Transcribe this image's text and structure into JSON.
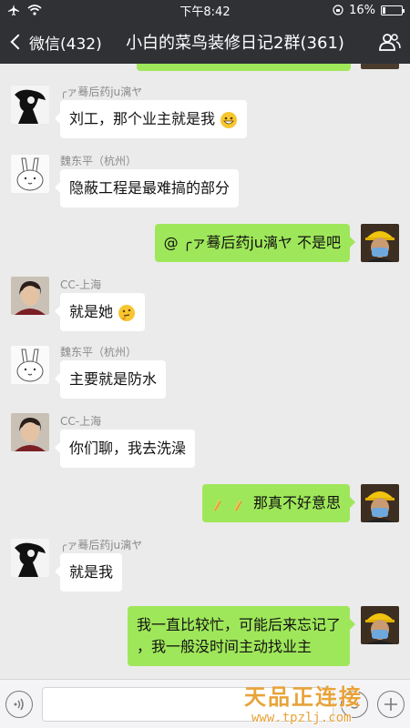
{
  "status": {
    "time": "下午8:42",
    "battery": "16%",
    "battery_level": 0.16
  },
  "nav": {
    "back_label": "微信(432)",
    "title": "小白的菜鸟装修日记2群(361)"
  },
  "messages": [
    {
      "sender": "╭ァ蓦后药ju漓ヤ",
      "text": "刘工，那个业主就是我",
      "emoji": "grin-emoji"
    },
    {
      "sender": "魏东平（杭州）",
      "text": "隐蔽工程是最难搞的部分"
    },
    {
      "text": "@ ╭ァ蓦后药ju漓ヤ  不是吧"
    },
    {
      "sender": "CC-上海",
      "text": "就是她",
      "emoji": "thinking-emoji"
    },
    {
      "sender": "魏东平（杭州）",
      "text": "主要就是防水"
    },
    {
      "sender": "CC-上海",
      "text": "你们聊，我去洗澡"
    },
    {
      "text": "那真不好意思",
      "emoji": "pray-emoji"
    },
    {
      "sender": "╭ァ蓦后药ju漓ヤ",
      "text": "就是我"
    },
    {
      "text_line1": "我一直比较忙，可能后来忘记了",
      "text_line2": "，我一般没时间主动找业主"
    }
  ],
  "watermark": {
    "title": "天品正连接",
    "url": "www.tpzlj.com"
  },
  "colors": {
    "nav_bg": "#2f3135",
    "chat_bg": "#ebebeb",
    "outgoing_bubble": "#9fe75a",
    "incoming_bubble": "#ffffff",
    "watermark": "#e8a33a"
  }
}
